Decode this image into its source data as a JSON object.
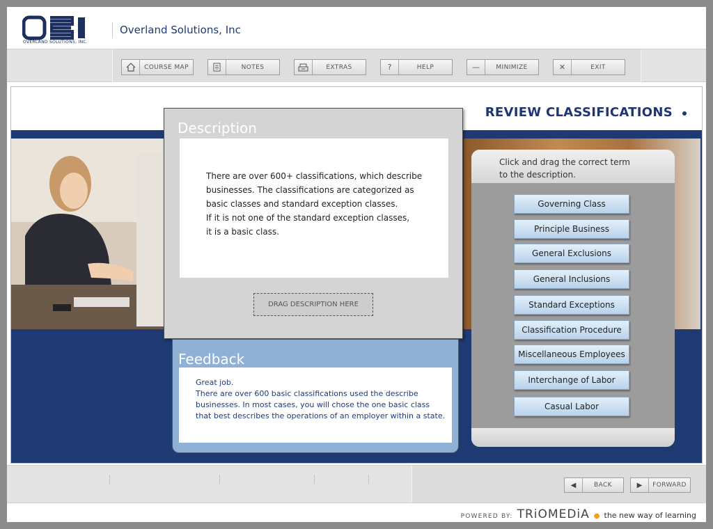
{
  "header": {
    "logo_text": "OSI",
    "logo_sub": "OVERLAND SOLUTIONS, INC.",
    "company": "Overland Solutions, Inc"
  },
  "toolbar": {
    "buttons": [
      {
        "label": "COURSE MAP",
        "icon": "home-icon"
      },
      {
        "label": "NOTES",
        "icon": "notes-icon"
      },
      {
        "label": "EXTRAS",
        "icon": "extras-icon"
      },
      {
        "label": "HELP",
        "icon": "help-icon"
      },
      {
        "label": "MINIMIZE",
        "icon": "minimize-icon"
      },
      {
        "label": "EXIT",
        "icon": "close-icon"
      }
    ]
  },
  "page": {
    "title": "REVIEW CLASSIFICATIONS"
  },
  "description": {
    "title": "Description",
    "text": "There are over 600+ classifications, which describe\nbusinesses.  The classifications are categorized as\nbasic classes and standard exception classes.\nIf it is not one of the standard exception classes,\nit is a basic class.",
    "drop_label": "DRAG DESCRIPTION HERE"
  },
  "feedback": {
    "title": "Feedback",
    "text": "Great job.\nThere are over 600 basic classifications used the describe\nbusinesses.  In most cases, you will chose the one basic class\nthat best describes the operations of an employer within a state."
  },
  "terms": {
    "instruction": "Click and drag the correct term\nto the description.",
    "items": [
      "Governing Class",
      "Principle Business",
      "General Exclusions",
      "General Inclusions",
      "Standard Exceptions",
      "Classification Procedure",
      "Miscellaneous Employees",
      "Interchange of Labor",
      "Casual Labor"
    ]
  },
  "footer": {
    "back_label": "BACK",
    "forward_label": "FORWARD",
    "powered_label": "POWERED BY:",
    "brand": "TRiOMEDiA",
    "tagline": "the new way of learning"
  },
  "colors": {
    "navy": "#1f3a73",
    "feedback_blue": "#8fb1d6",
    "term_button": "#c9def2"
  }
}
